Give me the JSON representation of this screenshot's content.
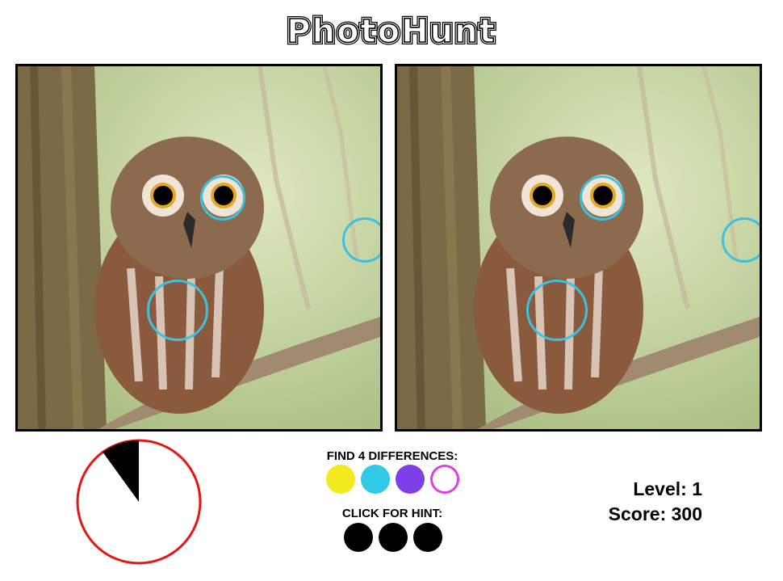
{
  "game": {
    "title": "PhotoHunt"
  },
  "differences": {
    "label": "FIND 4 DIFFERENCES:",
    "markers": [
      {
        "color": "#f2ea1c",
        "found": true
      },
      {
        "color": "#32c8e8",
        "found": true
      },
      {
        "color": "#7e3fe8",
        "found": true
      },
      {
        "color": "#e040e0",
        "found": false
      }
    ]
  },
  "hints": {
    "label": "CLICK FOR HINT:",
    "count": 3
  },
  "stats": {
    "level": "Level: 1",
    "score": "Score: 300"
  },
  "timer": {
    "elapsed_fraction": 0.1
  },
  "colors": {
    "ring": "#3ec1dc",
    "timer_border": "#e81515"
  }
}
